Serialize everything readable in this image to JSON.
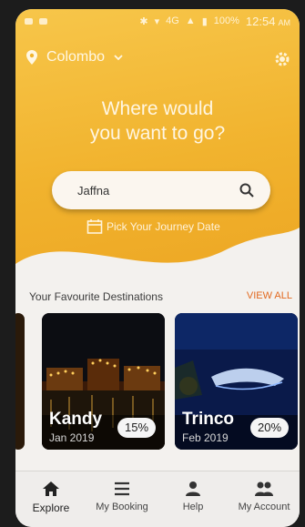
{
  "status": {
    "network": "4G",
    "battery": "100%",
    "time": "12:54",
    "ampm": "AM"
  },
  "header": {
    "location": "Colombo"
  },
  "hero": {
    "line1": "Where would",
    "line2": "you want to go?"
  },
  "search": {
    "value": "Jaffna"
  },
  "journey": {
    "label": "Pick Your Journey Date"
  },
  "favourites": {
    "title": "Your Favourite Destinations",
    "view_all": "VIEW ALL",
    "cards": [
      {
        "name": "Kandy",
        "date": "Jan 2019",
        "discount": "15%"
      },
      {
        "name": "Trinco",
        "date": "Feb 2019",
        "discount": "20%"
      }
    ]
  },
  "nav": {
    "items": [
      {
        "label": "Explore",
        "icon": "home-icon"
      },
      {
        "label": "My Booking",
        "icon": "list-icon"
      },
      {
        "label": "Help",
        "icon": "person-icon"
      },
      {
        "label": "My Account",
        "icon": "people-icon"
      }
    ]
  },
  "colors": {
    "accent": "#f1b32e",
    "view_all": "#e2691f"
  }
}
